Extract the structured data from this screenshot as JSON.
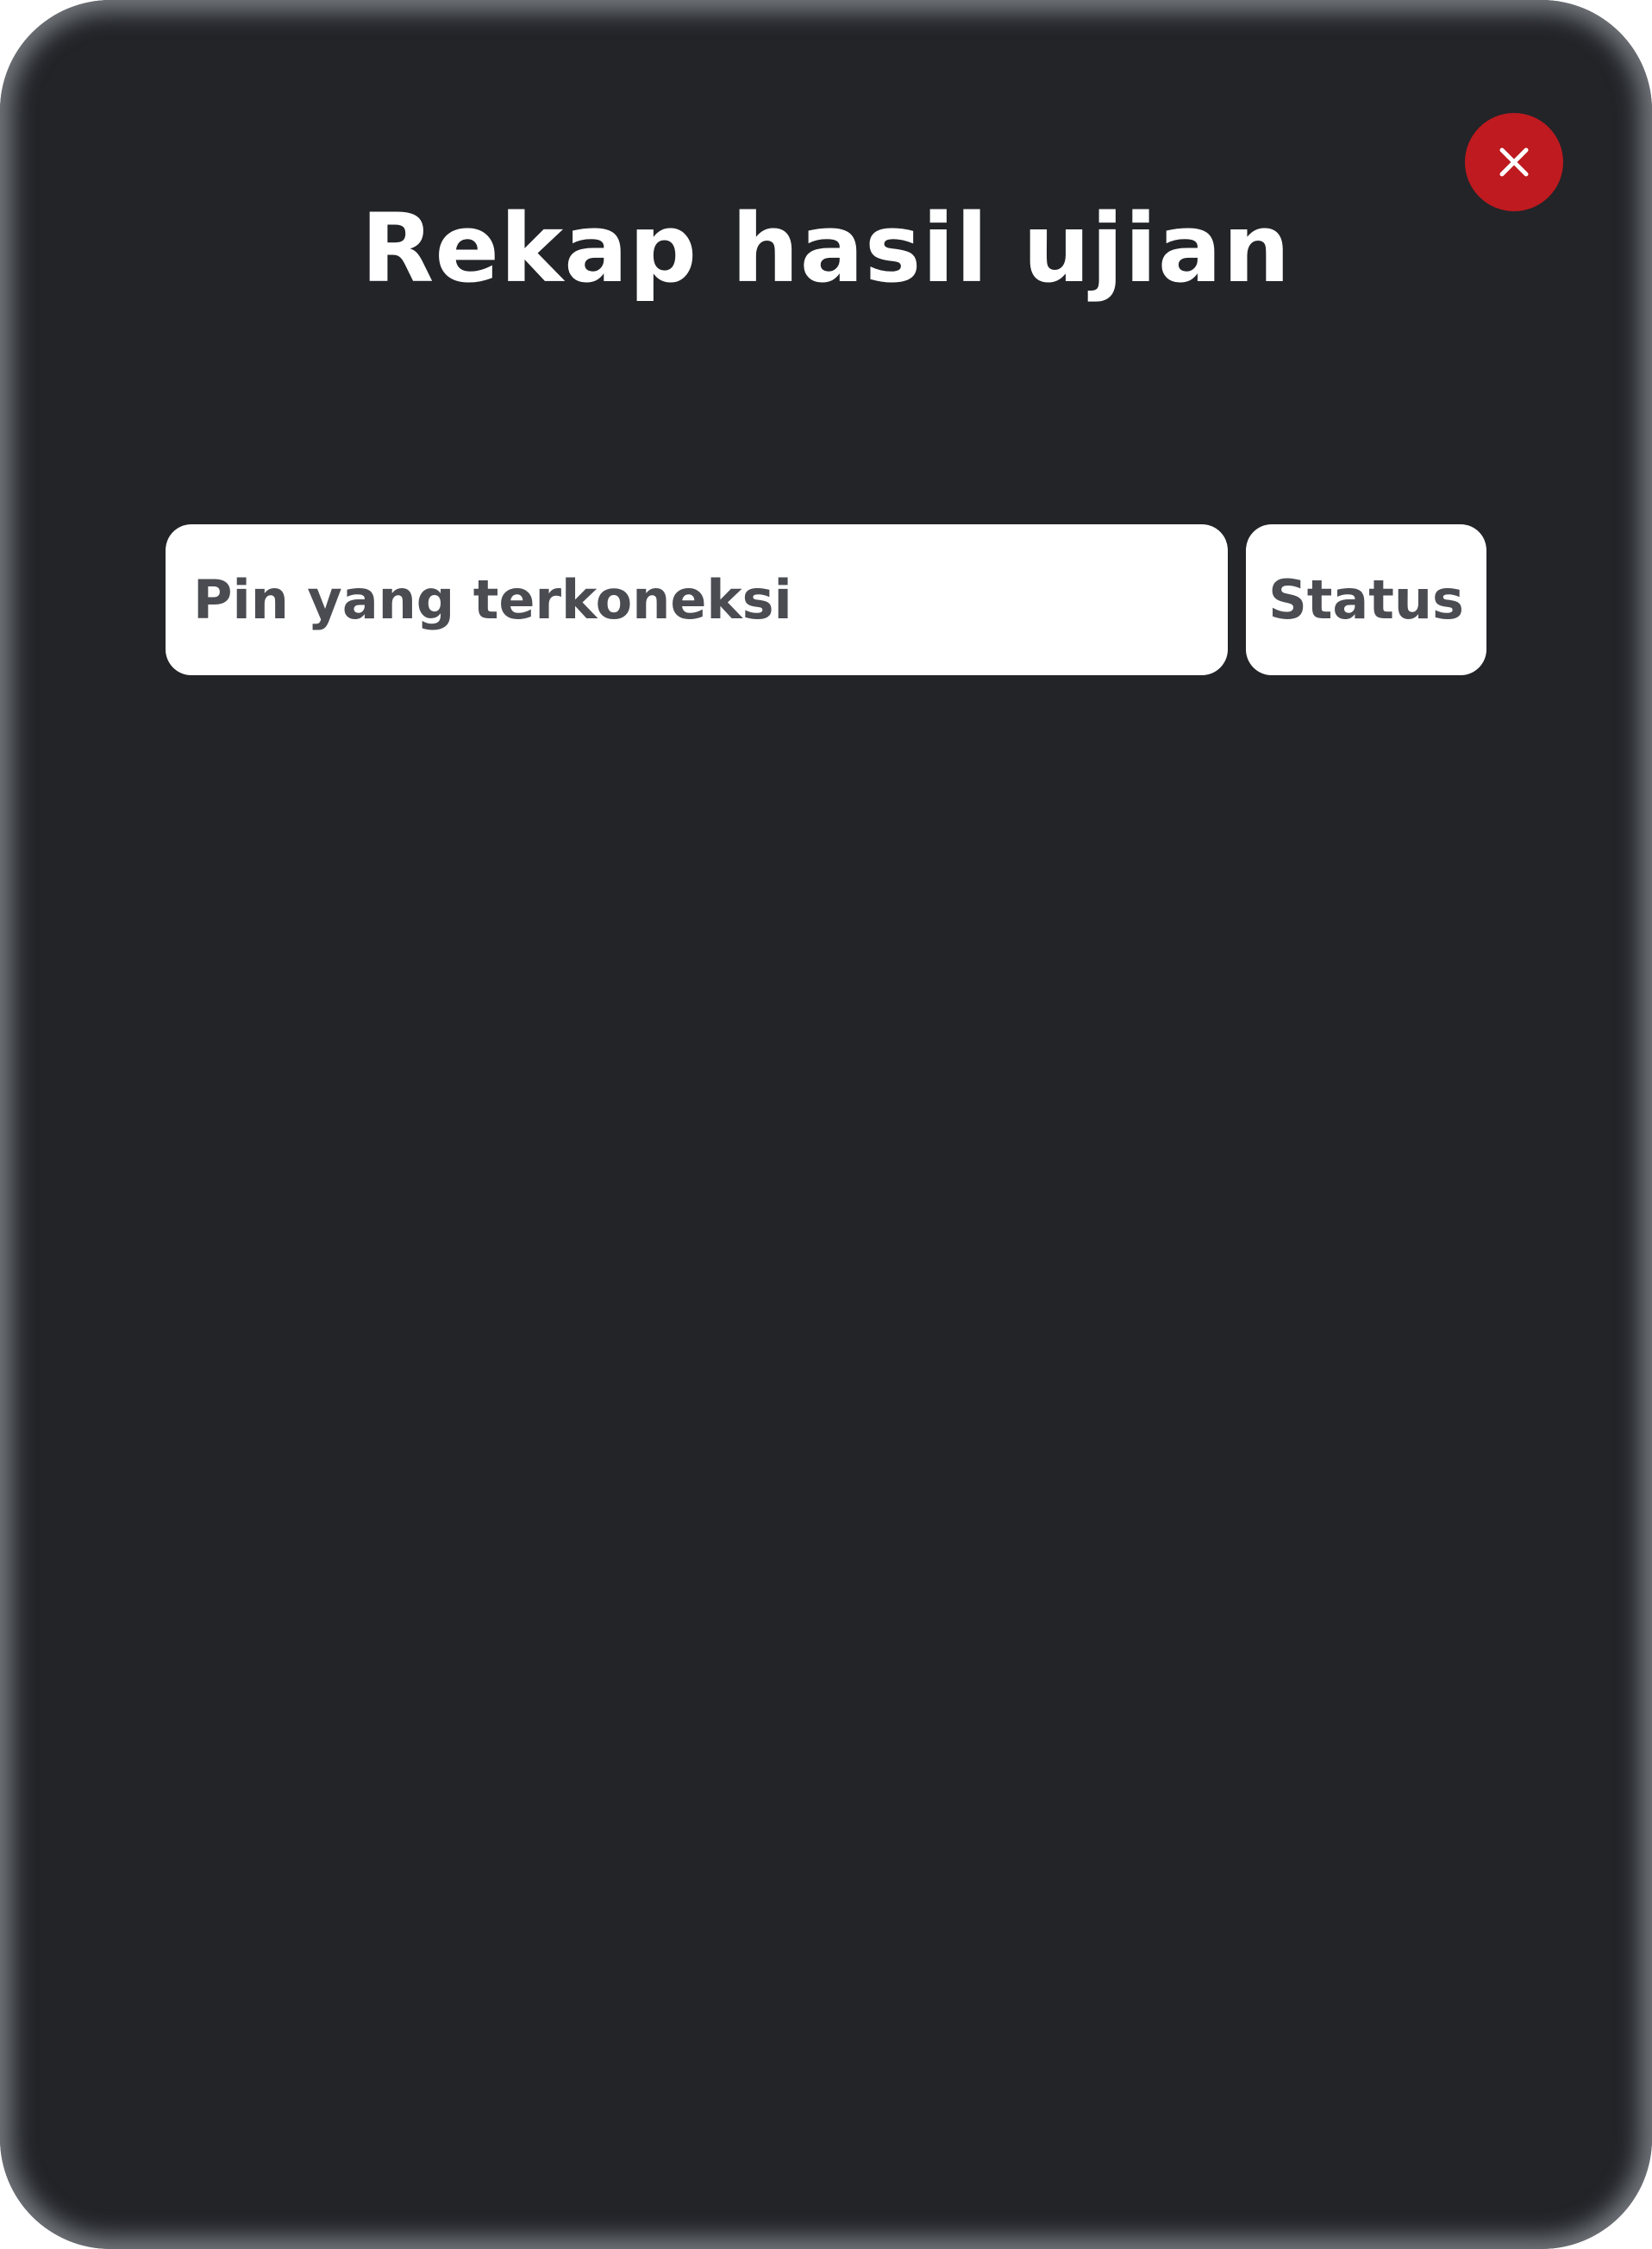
{
  "modal": {
    "title": "Rekap hasil ujian",
    "close_icon": "close-icon",
    "close_color": "#be1a1f",
    "background_color": "#222428"
  },
  "table": {
    "headers": {
      "pin": "Pin yang terkoneksi",
      "status": "Status"
    },
    "rows": []
  }
}
